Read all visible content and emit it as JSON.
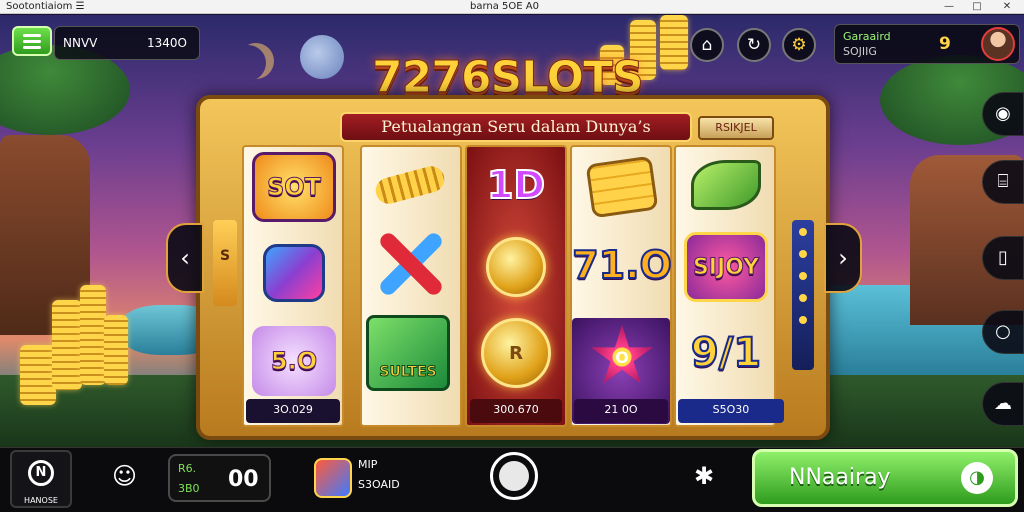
{
  "window": {
    "app_title": "Sootontiaiom ☰",
    "doc_title": "barna 5OE A0",
    "controls": [
      "—",
      "□",
      "✕"
    ]
  },
  "header": {
    "left_panel_label": "NNVV",
    "left_panel_value": "1340O",
    "player_name": "Garaaird",
    "player_sub": "SOJIIG",
    "player_number": "9",
    "icons": [
      "bank-icon",
      "refresh-icon",
      "gear-icon"
    ],
    "icon_glyphs": [
      "⌂",
      "↻",
      "⚙"
    ]
  },
  "game": {
    "title": "7276SLOTS",
    "subtitle": "Petualangan Seru dalam Dunya’s",
    "badge": "RSIKJEL",
    "left_strip": "S",
    "reels": [
      {
        "symbols": [
          "SOT",
          "",
          "5.O"
        ],
        "footer": "3O.029"
      },
      {
        "symbols": [
          "",
          "",
          "SULTES"
        ],
        "footer": ""
      },
      {
        "symbols": [
          "1D",
          "",
          "R"
        ],
        "footer": "300.670"
      },
      {
        "symbols": [
          "71.O",
          "",
          "O"
        ],
        "footer": "21 0O"
      },
      {
        "symbols": [
          "",
          "SIJOY",
          "9/1"
        ],
        "footer": "S5O30"
      }
    ],
    "prev_arrow": "‹",
    "next_arrow": "›"
  },
  "right_rail": {
    "icons": [
      "camera-icon",
      "briefcase-icon",
      "tablet-icon",
      "search-icon",
      "cloud-icon"
    ],
    "glyphs": [
      "◉",
      "⌸",
      "▯",
      "○",
      "☁"
    ]
  },
  "bottom": {
    "logo_text": "HANOSE",
    "logo_mark": "N",
    "profile_glyph": "☺",
    "stat_top": "R6.",
    "stat_bottom": "3B0",
    "stat_value": "00",
    "mini_label_top": "MIP",
    "mini_label_bottom": "S3OAID",
    "gear_glyph": "✱",
    "play_label": "NNaairay",
    "play_icon_glyph": "◑"
  },
  "colors": {
    "accent_green": "#2f9c1e",
    "gold": "#ffd23a",
    "ribbon_red": "#a21d22"
  }
}
